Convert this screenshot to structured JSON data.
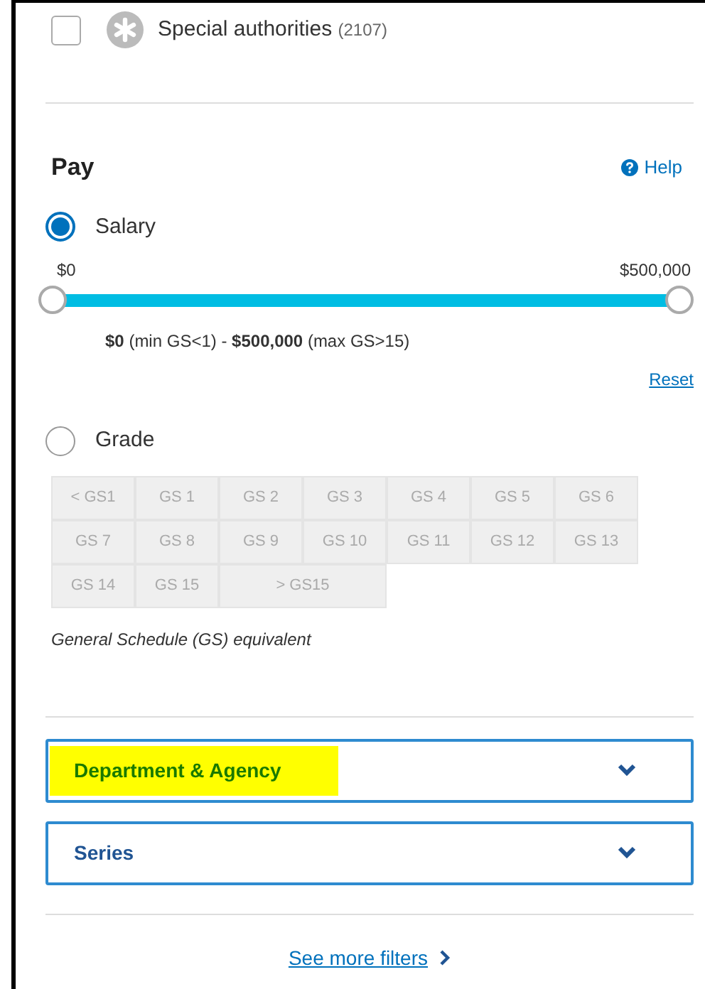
{
  "special_authorities": {
    "label": "Special authorities",
    "count": "(2107)",
    "checked": false
  },
  "pay": {
    "title": "Pay",
    "help": "Help",
    "options": [
      {
        "label": "Salary",
        "selected": true
      },
      {
        "label": "Grade",
        "selected": false
      }
    ],
    "slider": {
      "min_label": "$0",
      "max_label": "$500,000",
      "thumbs": [
        {
          "level": 0
        },
        {
          "level": 1
        }
      ],
      "summary": "**$0** (min GS<1) - **$500,000** (max GS>15)",
      "reset": "Reset"
    },
    "grades": [
      {
        "label": "< GS1",
        "disabled": true
      },
      {
        "label": "GS 1",
        "disabled": true
      },
      {
        "label": "GS 2",
        "disabled": true
      },
      {
        "label": "GS 3",
        "disabled": true
      },
      {
        "label": "GS 4",
        "disabled": true
      },
      {
        "label": "GS 5",
        "disabled": true
      },
      {
        "label": "GS 6",
        "disabled": true
      },
      {
        "label": "GS 7",
        "disabled": true
      },
      {
        "label": "GS 8",
        "disabled": true
      },
      {
        "label": "GS 9",
        "disabled": true
      },
      {
        "label": "GS 10",
        "disabled": true
      },
      {
        "label": "GS 11",
        "disabled": true
      },
      {
        "label": "GS 12",
        "disabled": true
      },
      {
        "label": "GS 13",
        "disabled": true
      },
      {
        "label": "GS 14",
        "disabled": true
      },
      {
        "label": "GS 15",
        "disabled": true
      },
      {
        "label": "> GS15",
        "disabled": true,
        "wide": true
      }
    ],
    "caption": "General Schedule (GS) equivalent"
  },
  "accordions": [
    {
      "label": "Department & Agency",
      "expanded": false,
      "highlighted": true
    },
    {
      "label": "Series",
      "expanded": false,
      "highlighted": false
    }
  ],
  "more_filters": "See more filters"
}
